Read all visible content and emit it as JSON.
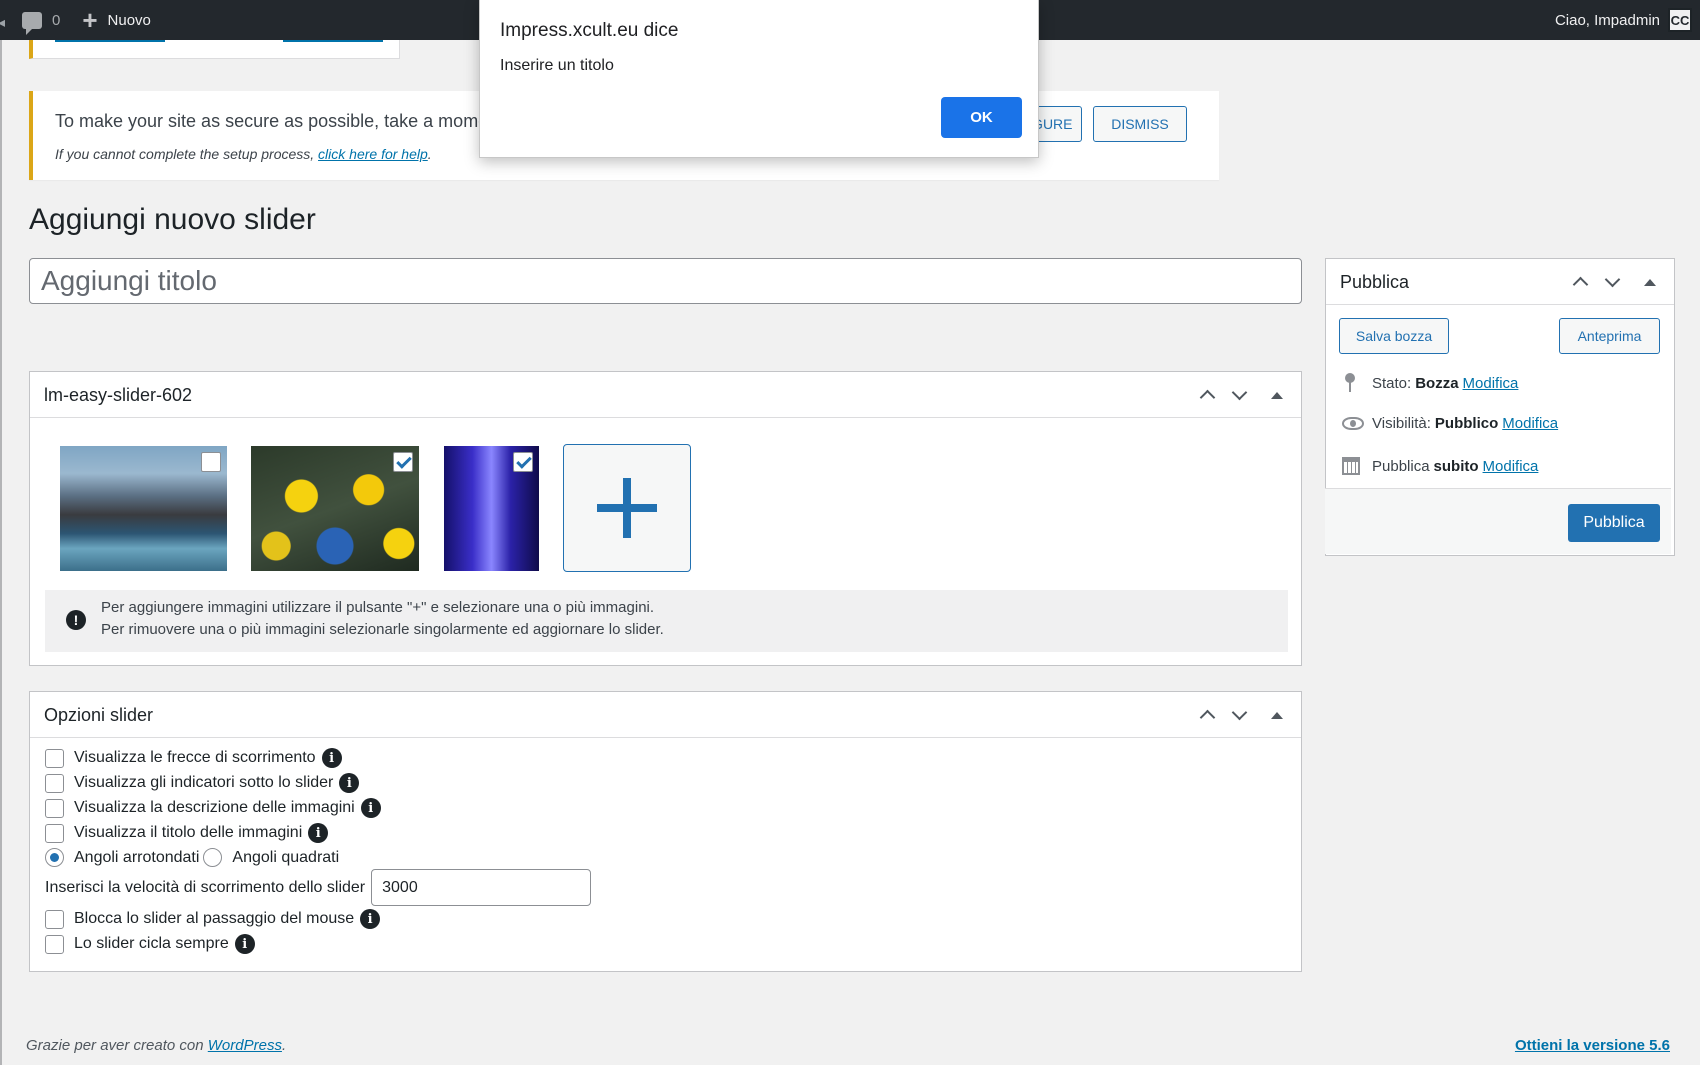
{
  "adminbar": {
    "comments_count": "0",
    "new_label": "Nuovo",
    "greeting": "Ciao, Impadmin",
    "avatar_text": "CC"
  },
  "security_notice": {
    "message": "To make your site as secure as possible, take a moment",
    "sub_text": "If you cannot complete the setup process,",
    "sub_link": "click here for help",
    "sub_end": ".",
    "configure_label": "NFIGURE",
    "dismiss_label": "DISMISS"
  },
  "page": {
    "title": "Aggiungi nuovo slider",
    "title_placeholder": "Aggiungi titolo"
  },
  "slider_box": {
    "title": "lm-easy-slider-602",
    "images": [
      {
        "name": "amsterdam-canal",
        "selected": false
      },
      {
        "name": "rubber-ducks",
        "selected": true
      },
      {
        "name": "blue-corridor",
        "selected": true
      }
    ],
    "info_line1": "Per aggiungere immagini utilizzare il pulsante \"+\" e selezionare una o più immagini.",
    "info_line2": "Per rimuovere una o più immagini selezionarle singolarmente ed aggiornare lo slider."
  },
  "options_box": {
    "title": "Opzioni slider",
    "checkboxes": [
      {
        "label": "Visualizza le frecce di scorrimento",
        "checked": false
      },
      {
        "label": "Visualizza gli indicatori sotto lo slider",
        "checked": false
      },
      {
        "label": "Visualizza la descrizione delle immagini",
        "checked": false
      },
      {
        "label": "Visualizza il titolo delle immagini",
        "checked": false
      }
    ],
    "radio_rounded": "Angoli arrotondati",
    "radio_square": "Angoli quadrati",
    "speed_label": "Inserisci la velocità di scorrimento dello slider",
    "speed_value": "3000",
    "lock_label": "Blocca lo slider al passaggio del mouse",
    "loop_label": "Lo slider cicla sempre"
  },
  "publish_box": {
    "title": "Pubblica",
    "save_draft": "Salva bozza",
    "preview": "Anteprima",
    "status_label": "Stato:",
    "status_value": "Bozza",
    "visibility_label": "Visibilità:",
    "visibility_value": "Pubblico",
    "publish_label": "Pubblica",
    "publish_value": "subito",
    "edit_link": "Modifica",
    "publish_button": "Pubblica"
  },
  "footer": {
    "left_text": "Grazie per aver creato con",
    "left_link": "WordPress",
    "left_end": ".",
    "right_link": "Ottieni la versione 5.6"
  },
  "dialog": {
    "title": "Impress.xcult.eu dice",
    "message": "Inserire un titolo",
    "ok_label": "OK"
  },
  "colors": {
    "accent": "#2271b1",
    "adminbar": "#23282d",
    "warning": "#dba617",
    "dialog_ok": "#1a73e8"
  }
}
